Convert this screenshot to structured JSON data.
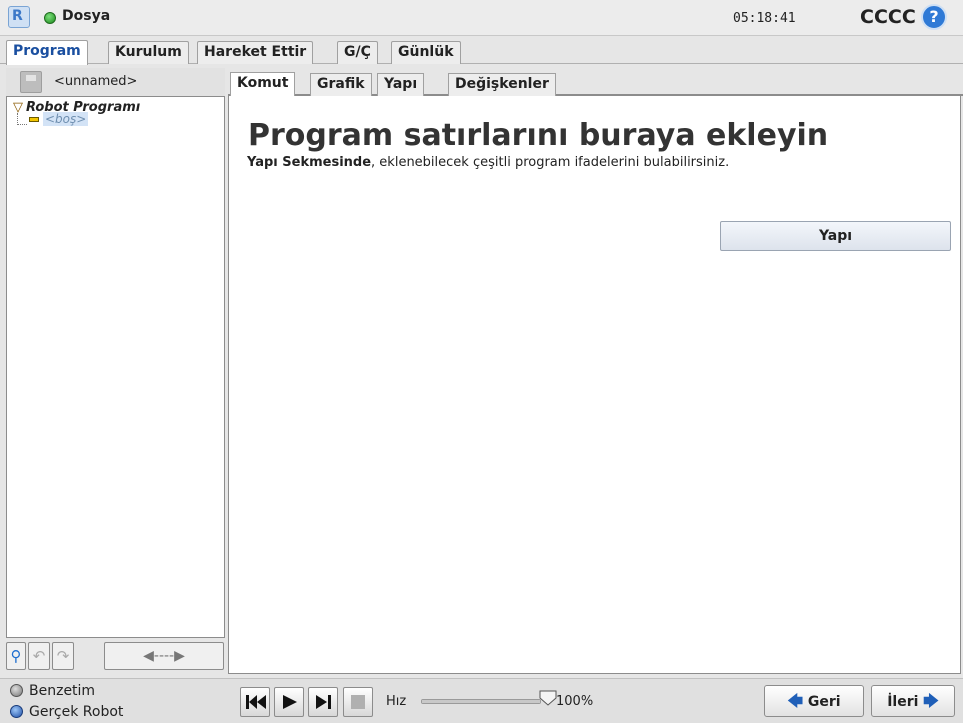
{
  "titlebar": {
    "logo_icon": "ur-logo-icon",
    "file_menu": "Dosya",
    "clock": "05:18:41",
    "robot_name": "CCCC",
    "help": "?"
  },
  "main_tabs": [
    {
      "label": "Program",
      "active": true
    },
    {
      "label": "Kurulum",
      "active": false
    },
    {
      "label": "Hareket Ettir",
      "active": false
    },
    {
      "label": "G/Ç",
      "active": false
    },
    {
      "label": "Günlük",
      "active": false
    }
  ],
  "program": {
    "name": "<unnamed>",
    "tree_root": "Robot Programı",
    "tree_leaf": "<boş>"
  },
  "sub_tabs": [
    {
      "label": "Komut",
      "active": true
    },
    {
      "label": "Grafik",
      "active": false
    },
    {
      "label": "Yapı",
      "active": false
    },
    {
      "label": "Değişkenler",
      "active": false
    }
  ],
  "command": {
    "heading": "Program satırlarını buraya ekleyin",
    "hint_bold": "Yapı Sekmesinde",
    "hint_rest": ", eklenebilecek çeşitli program ifadelerini bulabilirsiniz.",
    "structure_button": "Yapı"
  },
  "tree_tools": {
    "move_label": "◀----▶"
  },
  "bottom": {
    "mode_sim": "Benzetim",
    "mode_real": "Gerçek Robot",
    "speed_label": "Hız",
    "speed_value": "100%",
    "speed_fraction": 1.0,
    "back_label": "Geri",
    "next_label": "İleri"
  },
  "colors": {
    "accent": "#1f5fb8",
    "active_tab_text": "#1a4fa0",
    "status_green": "#1a8a1a"
  }
}
